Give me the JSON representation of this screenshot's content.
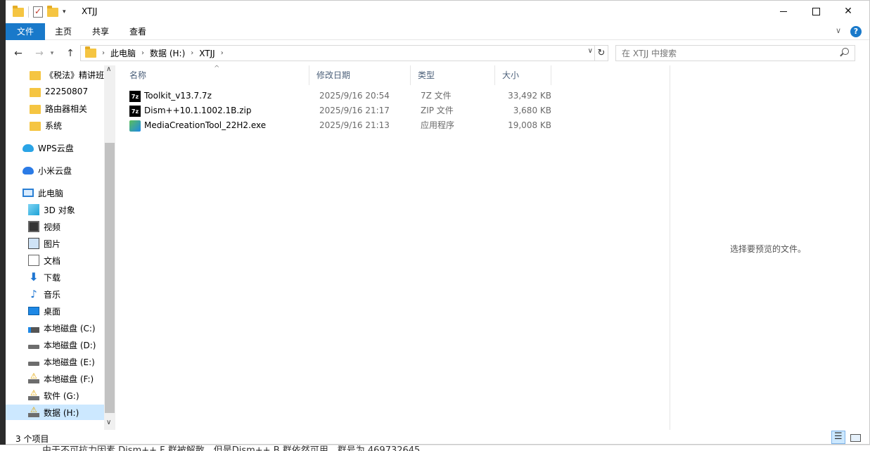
{
  "window": {
    "title": "XTJJ"
  },
  "ribbon": {
    "file": "文件",
    "home": "主页",
    "share": "共享",
    "view": "查看"
  },
  "address": {
    "crumbs": [
      "此电脑",
      "数据 (H:)",
      "XTJJ"
    ],
    "search_placeholder": "在 XTJJ 中搜索"
  },
  "navpane": {
    "items": [
      {
        "label": "《税法》精讲班",
        "icon": "folder-icon"
      },
      {
        "label": "22250807",
        "icon": "folder-icon"
      },
      {
        "label": "路由器相关",
        "icon": "folder-icon"
      },
      {
        "label": "系统",
        "icon": "folder-icon"
      },
      {
        "label": "WPS云盘",
        "icon": "wps-cloud-icon"
      },
      {
        "label": "小米云盘",
        "icon": "mi-cloud-icon"
      },
      {
        "label": "此电脑",
        "icon": "computer-icon"
      },
      {
        "label": "3D 对象",
        "icon": "3d-objects-icon"
      },
      {
        "label": "视频",
        "icon": "video-icon"
      },
      {
        "label": "图片",
        "icon": "picture-icon"
      },
      {
        "label": "文档",
        "icon": "document-icon"
      },
      {
        "label": "下载",
        "icon": "download-icon"
      },
      {
        "label": "音乐",
        "icon": "music-icon"
      },
      {
        "label": "桌面",
        "icon": "desktop-icon"
      },
      {
        "label": "本地磁盘 (C:)",
        "icon": "system-drive-icon"
      },
      {
        "label": "本地磁盘 (D:)",
        "icon": "drive-icon"
      },
      {
        "label": "本地磁盘 (E:)",
        "icon": "drive-icon"
      },
      {
        "label": "本地磁盘 (F:)",
        "icon": "drive-warning-icon"
      },
      {
        "label": "软件 (G:)",
        "icon": "drive-warning-icon"
      },
      {
        "label": "数据 (H:)",
        "icon": "drive-warning-icon"
      }
    ]
  },
  "filelist": {
    "columns": {
      "name": "名称",
      "date": "修改日期",
      "type": "类型",
      "size": "大小"
    },
    "rows": [
      {
        "name": "Toolkit_v13.7.7z",
        "date": "2025/9/16 20:54",
        "type": "7Z 文件",
        "size": "33,492 KB",
        "icon": "7z-archive-icon"
      },
      {
        "name": "Dism++10.1.1002.1B.zip",
        "date": "2025/9/16 21:17",
        "type": "ZIP 文件",
        "size": "3,680 KB",
        "icon": "7z-archive-icon"
      },
      {
        "name": "MediaCreationTool_22H2.exe",
        "date": "2025/9/16 21:13",
        "type": "应用程序",
        "size": "19,008 KB",
        "icon": "exe-app-icon"
      }
    ]
  },
  "preview": {
    "message": "选择要预览的文件。"
  },
  "status": {
    "count": "3 个项目"
  },
  "background": {
    "text": "由于不可抗力因素 Dism++ F 群被解散，但是Dism++ B 群依然可用，群号为 469732645"
  }
}
